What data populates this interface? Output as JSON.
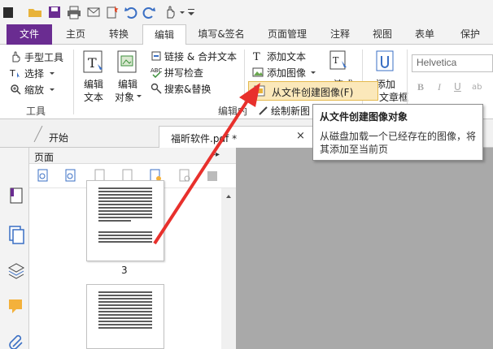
{
  "ribbon_tabs": {
    "file": "文件",
    "home": "主页",
    "convert": "转换",
    "edit": "编辑",
    "fill_sign": "填写&签名",
    "page_manage": "页面管理",
    "comment": "注释",
    "view": "视图",
    "form": "表单",
    "protect": "保护"
  },
  "tools_group": {
    "hand_tool": "手型工具",
    "select": "选择",
    "zoom": "缩放",
    "group_label": "工具"
  },
  "edit_group": {
    "edit_text_1": "编辑",
    "edit_text_2": "文本",
    "edit_object_1": "编辑",
    "edit_object_2": "对象",
    "link_merge": "链接 & 合并文本",
    "spell_check": "拼写检查",
    "search_replace": "搜索&替换",
    "group_label": "编辑内"
  },
  "insert_group": {
    "add_text": "添加文本",
    "add_image": "添加图像",
    "draw_new_partial": "绘制新图",
    "type_partial": "流式",
    "add_label": "添加",
    "article_partial": "文章框"
  },
  "font_box": {
    "font_name": "Helvetica"
  },
  "dropdown": {
    "item": "从文件创建图像(F)"
  },
  "tooltip": {
    "title": "从文件创建图像对象",
    "body": "从磁盘加载一个已经存在的图像，将其添加至当前页"
  },
  "doc_tabs": {
    "start": "开始",
    "file": "福昕软件.pdf *",
    "close": "×"
  },
  "pages_panel": {
    "title": "页面",
    "collapse": "▸▸",
    "page_number": "3"
  },
  "colors": {
    "file_tab": "#6a2c91",
    "menu_highlight": "#fbe8ba",
    "arrow": "#e8302c"
  }
}
